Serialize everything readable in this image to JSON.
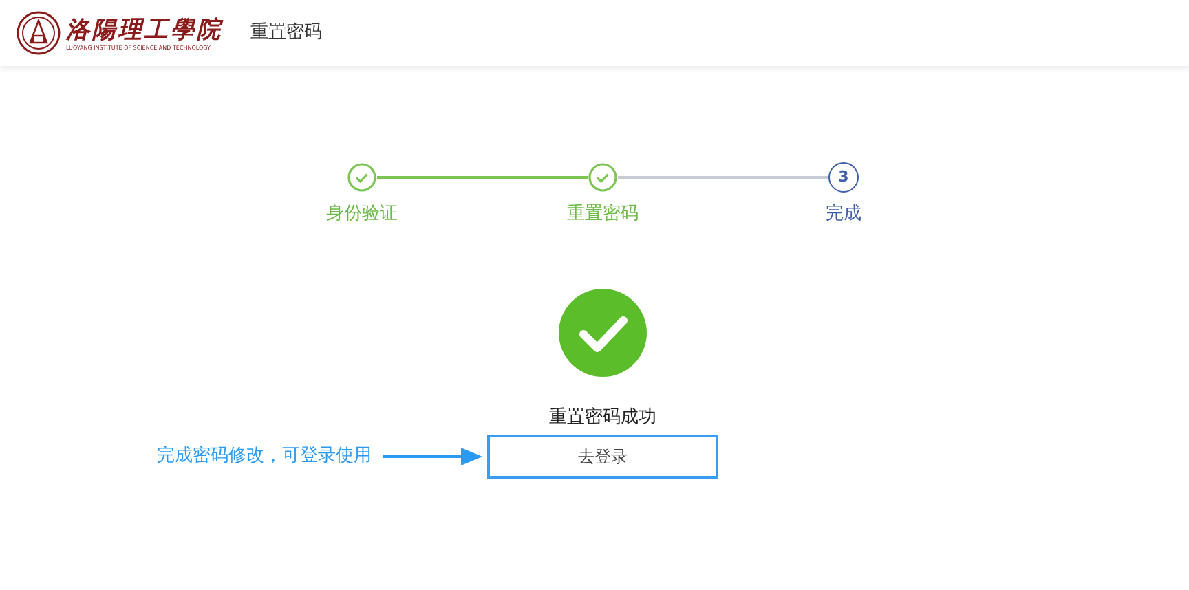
{
  "header": {
    "logo_text": "洛陽理工學院",
    "logo_subtext": "LUOYANG INSTITUTE OF SCIENCE AND TECHNOLOGY",
    "title": "重置密码"
  },
  "steps": [
    {
      "label": "身份验证",
      "completed": true
    },
    {
      "label": "重置密码",
      "completed": true
    },
    {
      "label": "完成",
      "completed": false,
      "number": "3"
    }
  ],
  "result": {
    "message": "重置密码成功",
    "button": "去登录"
  },
  "annotation": {
    "text": "完成密码修改，可登录使用"
  }
}
